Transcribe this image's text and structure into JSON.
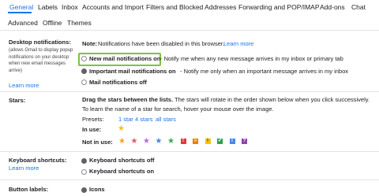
{
  "tabs": [
    "General",
    "Labels",
    "Inbox",
    "Accounts and Import",
    "Filters and Blocked Addresses",
    "Forwarding and POP/IMAP",
    "Add-ons",
    "Chat",
    "Advanced",
    "Offline",
    "Themes"
  ],
  "desktop": {
    "title": "Desktop notifications:",
    "description": "(allows Gmail to display popup notifications on your desktop when new email messages arrive)",
    "learn_more": "Learn more",
    "note_label": "Note:",
    "note_text": "Notifications have been disabled in this browser.",
    "note_link": "Learn more",
    "opt1_label": "New mail notifications on",
    "opt1_desc": "- Notify me when any new message arrives in my inbox or primary tab",
    "opt2_label": "Important mail notifications on",
    "opt2_desc": "- Notify me only when an important message arrives in my inbox",
    "opt3_label": "Mail notifications off",
    "selected": "opt2"
  },
  "stars": {
    "title": "Stars:",
    "desc_bold": "Drag the stars between the lists.",
    "desc_rest": "The stars will rotate in the order shown below when you click successively. To learn the name of a star for search, hover your mouse over the image.",
    "presets_label": "Presets:",
    "preset1": "1 star",
    "preset4": "4 stars",
    "preset_all": "all stars",
    "in_use_label": "In use:",
    "not_in_use_label": "Not in use:",
    "in_use_icon": "yellow-star-icon",
    "not_in_use_icons": [
      {
        "name": "orange-star-icon",
        "shape": "star",
        "color": "#f6a02d",
        "glyph": ""
      },
      {
        "name": "red-star-icon",
        "shape": "star",
        "color": "#e65a5a",
        "glyph": ""
      },
      {
        "name": "purple-star-icon",
        "shape": "star",
        "color": "#b06ee0",
        "glyph": ""
      },
      {
        "name": "blue-star-icon",
        "shape": "star",
        "color": "#4a86e8",
        "glyph": ""
      },
      {
        "name": "green-star-icon",
        "shape": "star",
        "color": "#3aa757",
        "glyph": ""
      },
      {
        "name": "red-bang-icon",
        "shape": "square",
        "color": "#e53935",
        "glyph": "!"
      },
      {
        "name": "orange-guillemet-icon",
        "shape": "square",
        "color": "#f57c00",
        "glyph": "»"
      },
      {
        "name": "yellow-bang-icon",
        "shape": "square",
        "color": "#f4c20d",
        "glyph": "!"
      },
      {
        "name": "green-check-icon",
        "shape": "square",
        "color": "#2e9e4f",
        "glyph": "✔"
      },
      {
        "name": "blue-info-icon",
        "shape": "square",
        "color": "#4a86e8",
        "glyph": "i"
      },
      {
        "name": "purple-question-icon",
        "shape": "square",
        "color": "#8e44ad",
        "glyph": "?"
      }
    ]
  },
  "keyboard": {
    "title": "Keyboard shortcuts:",
    "learn_more": "Learn more",
    "opt_off": "Keyboard shortcuts off",
    "opt_on": "Keyboard shortcuts on",
    "selected": "off"
  },
  "button_labels": {
    "title": "Button labels:",
    "opt_icons": "Icons",
    "selected": "icons"
  },
  "colors": {
    "accent": "#1a73e8",
    "highlight": "#7ec242",
    "in_use_star": "#f4c20d"
  }
}
